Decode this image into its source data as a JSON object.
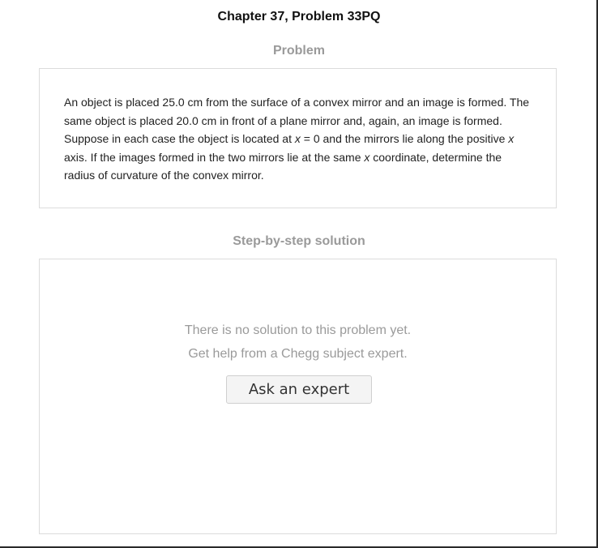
{
  "header": {
    "title": "Chapter 37, Problem 33PQ"
  },
  "problem": {
    "heading": "Problem",
    "segments": [
      "An object is placed 25.0 cm from the surface of a convex mirror and an image is formed. The same object is placed 20.0 cm in front of a plane mirror and, again, an image is formed. Suppose in each case the object is located at ",
      "x",
      " = 0 and the mirrors lie along the positive ",
      "x",
      " axis. If the images formed in the two mirrors lie at the same ",
      "x",
      " coordinate, determine the radius of curvature of the convex mirror."
    ]
  },
  "solution": {
    "heading": "Step-by-step solution",
    "no_solution_text": "There is no solution to this problem yet.",
    "help_text": "Get help from a Chegg subject expert.",
    "ask_button_label": "Ask an expert"
  }
}
